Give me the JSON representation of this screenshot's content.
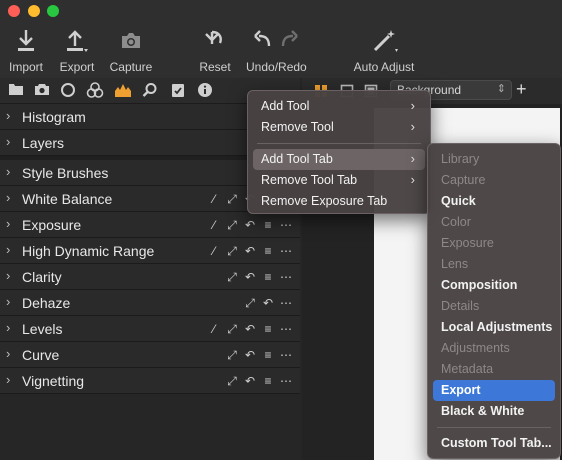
{
  "window": {
    "traffic_lights": [
      {
        "name": "close",
        "color": "#ff5f57"
      },
      {
        "name": "minimize",
        "color": "#febc2e"
      },
      {
        "name": "maximize",
        "color": "#28c840"
      }
    ]
  },
  "toolbar": {
    "import_label": "Import",
    "export_label": "Export",
    "capture_label": "Capture",
    "reset_label": "Reset",
    "undo_redo_label": "Undo/Redo",
    "auto_adjust_label": "Auto Adjust"
  },
  "tool_tabs": {
    "icons": [
      "folder-icon",
      "camera-icon",
      "circle-icon",
      "color-circles-icon",
      "exposure-icon",
      "magnifier-icon",
      "checklist-icon",
      "info-icon"
    ],
    "active_index": 4,
    "active_color": "#f0a030"
  },
  "viewer": {
    "background_select": "Background"
  },
  "tools": [
    {
      "label": "Histogram",
      "actions": []
    },
    {
      "label": "Layers",
      "actions": []
    },
    {
      "label": "Style Brushes",
      "actions": []
    },
    {
      "label": "White Balance",
      "actions": [
        "picker",
        "expand",
        "reset",
        "presets",
        "more"
      ]
    },
    {
      "label": "Exposure",
      "actions": [
        "picker",
        "expand",
        "reset",
        "presets",
        "more"
      ]
    },
    {
      "label": "High Dynamic Range",
      "actions": [
        "picker",
        "expand",
        "reset",
        "presets",
        "more"
      ]
    },
    {
      "label": "Clarity",
      "actions": [
        "expand",
        "reset",
        "presets",
        "more"
      ]
    },
    {
      "label": "Dehaze",
      "actions": [
        "expand",
        "reset",
        "more"
      ]
    },
    {
      "label": "Levels",
      "actions": [
        "picker",
        "expand",
        "reset",
        "presets",
        "more"
      ]
    },
    {
      "label": "Curve",
      "actions": [
        "expand",
        "reset",
        "presets",
        "more"
      ]
    },
    {
      "label": "Vignetting",
      "actions": [
        "expand",
        "reset",
        "presets",
        "more"
      ]
    }
  ],
  "context_menu": {
    "items": [
      {
        "label": "Add Tool",
        "submenu": true
      },
      {
        "label": "Remove Tool",
        "submenu": true
      },
      {
        "label": "Add Tool Tab",
        "submenu": true,
        "highlighted": true
      },
      {
        "label": "Remove Tool Tab",
        "submenu": true
      },
      {
        "label": "Remove Exposure Tab",
        "submenu": false
      }
    ]
  },
  "submenu": {
    "items": [
      {
        "label": "Library",
        "enabled": false
      },
      {
        "label": "Capture",
        "enabled": false
      },
      {
        "label": "Quick",
        "enabled": true
      },
      {
        "label": "Color",
        "enabled": false
      },
      {
        "label": "Exposure",
        "enabled": false
      },
      {
        "label": "Lens",
        "enabled": false
      },
      {
        "label": "Composition",
        "enabled": true
      },
      {
        "label": "Details",
        "enabled": false
      },
      {
        "label": "Local Adjustments",
        "enabled": true
      },
      {
        "label": "Adjustments",
        "enabled": false
      },
      {
        "label": "Metadata",
        "enabled": false
      },
      {
        "label": "Export",
        "enabled": true,
        "selected": true
      },
      {
        "label": "Black & White",
        "enabled": true
      }
    ],
    "custom_label": "Custom Tool Tab..."
  },
  "colors": {
    "selection": "#3d78d8",
    "menu_bg": "#484242"
  }
}
